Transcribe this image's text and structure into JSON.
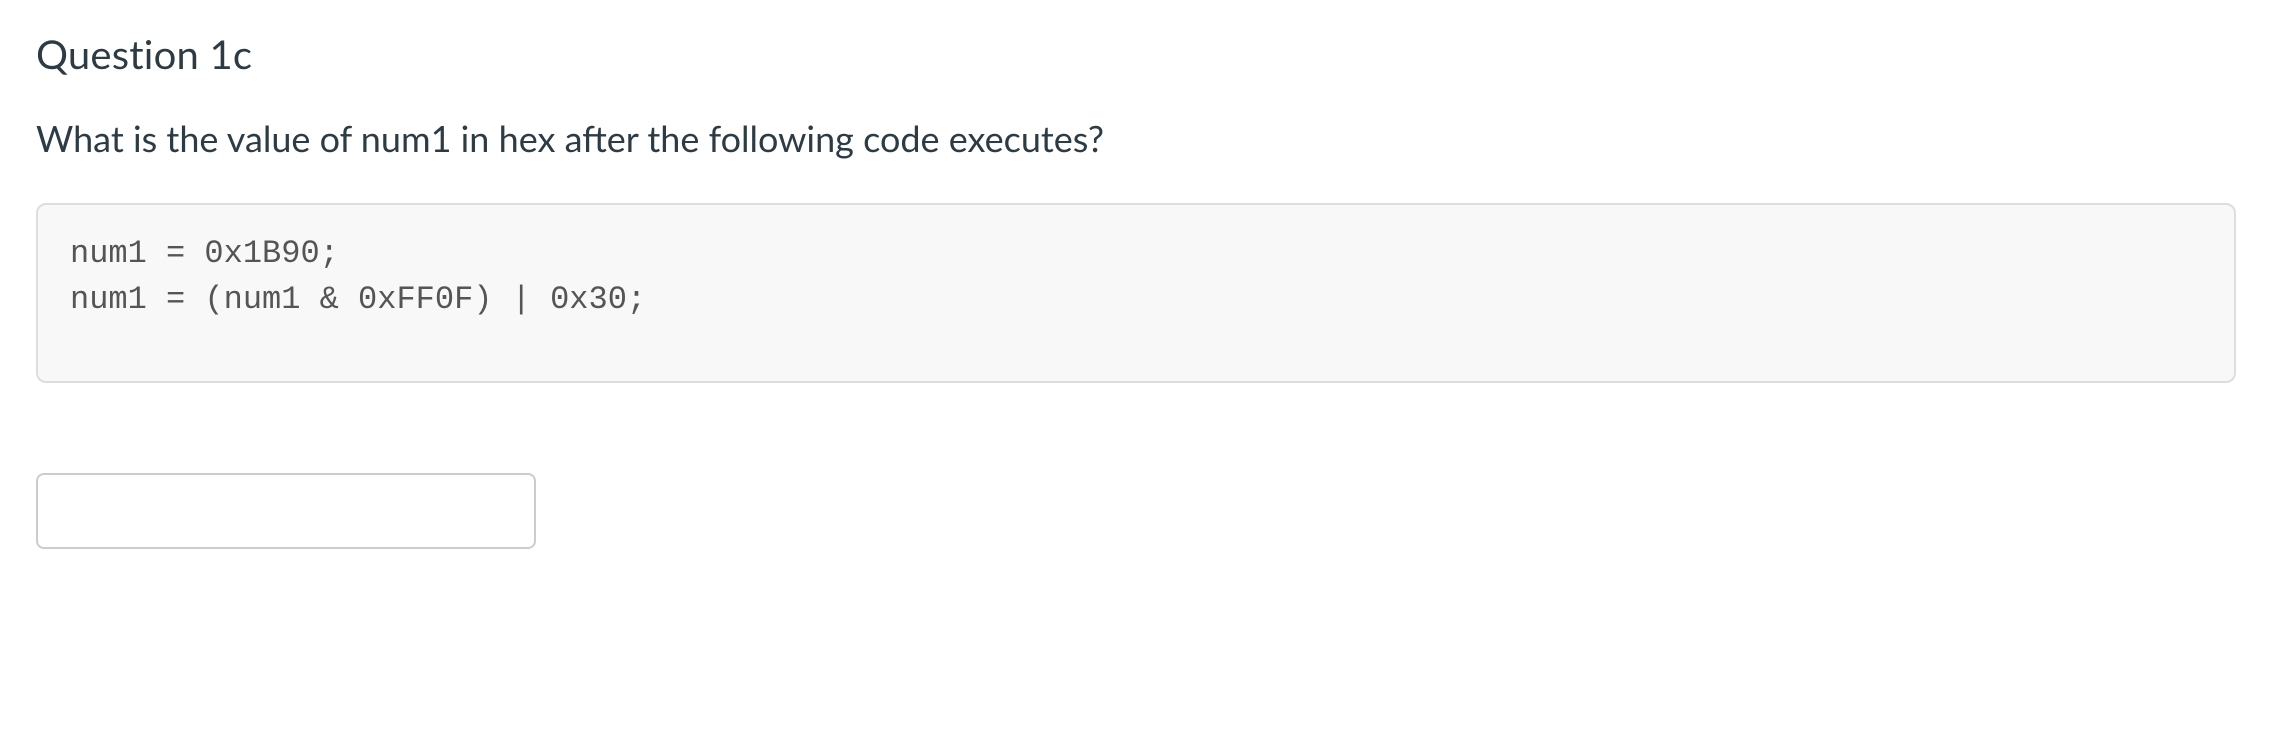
{
  "question": {
    "title": "Question 1c",
    "prompt": "What is the value of num1 in hex after the following code executes?",
    "code_lines": [
      "num1 = 0x1B90;",
      "num1 = (num1 & 0xFF0F) | 0x30;"
    ],
    "answer_value": ""
  }
}
